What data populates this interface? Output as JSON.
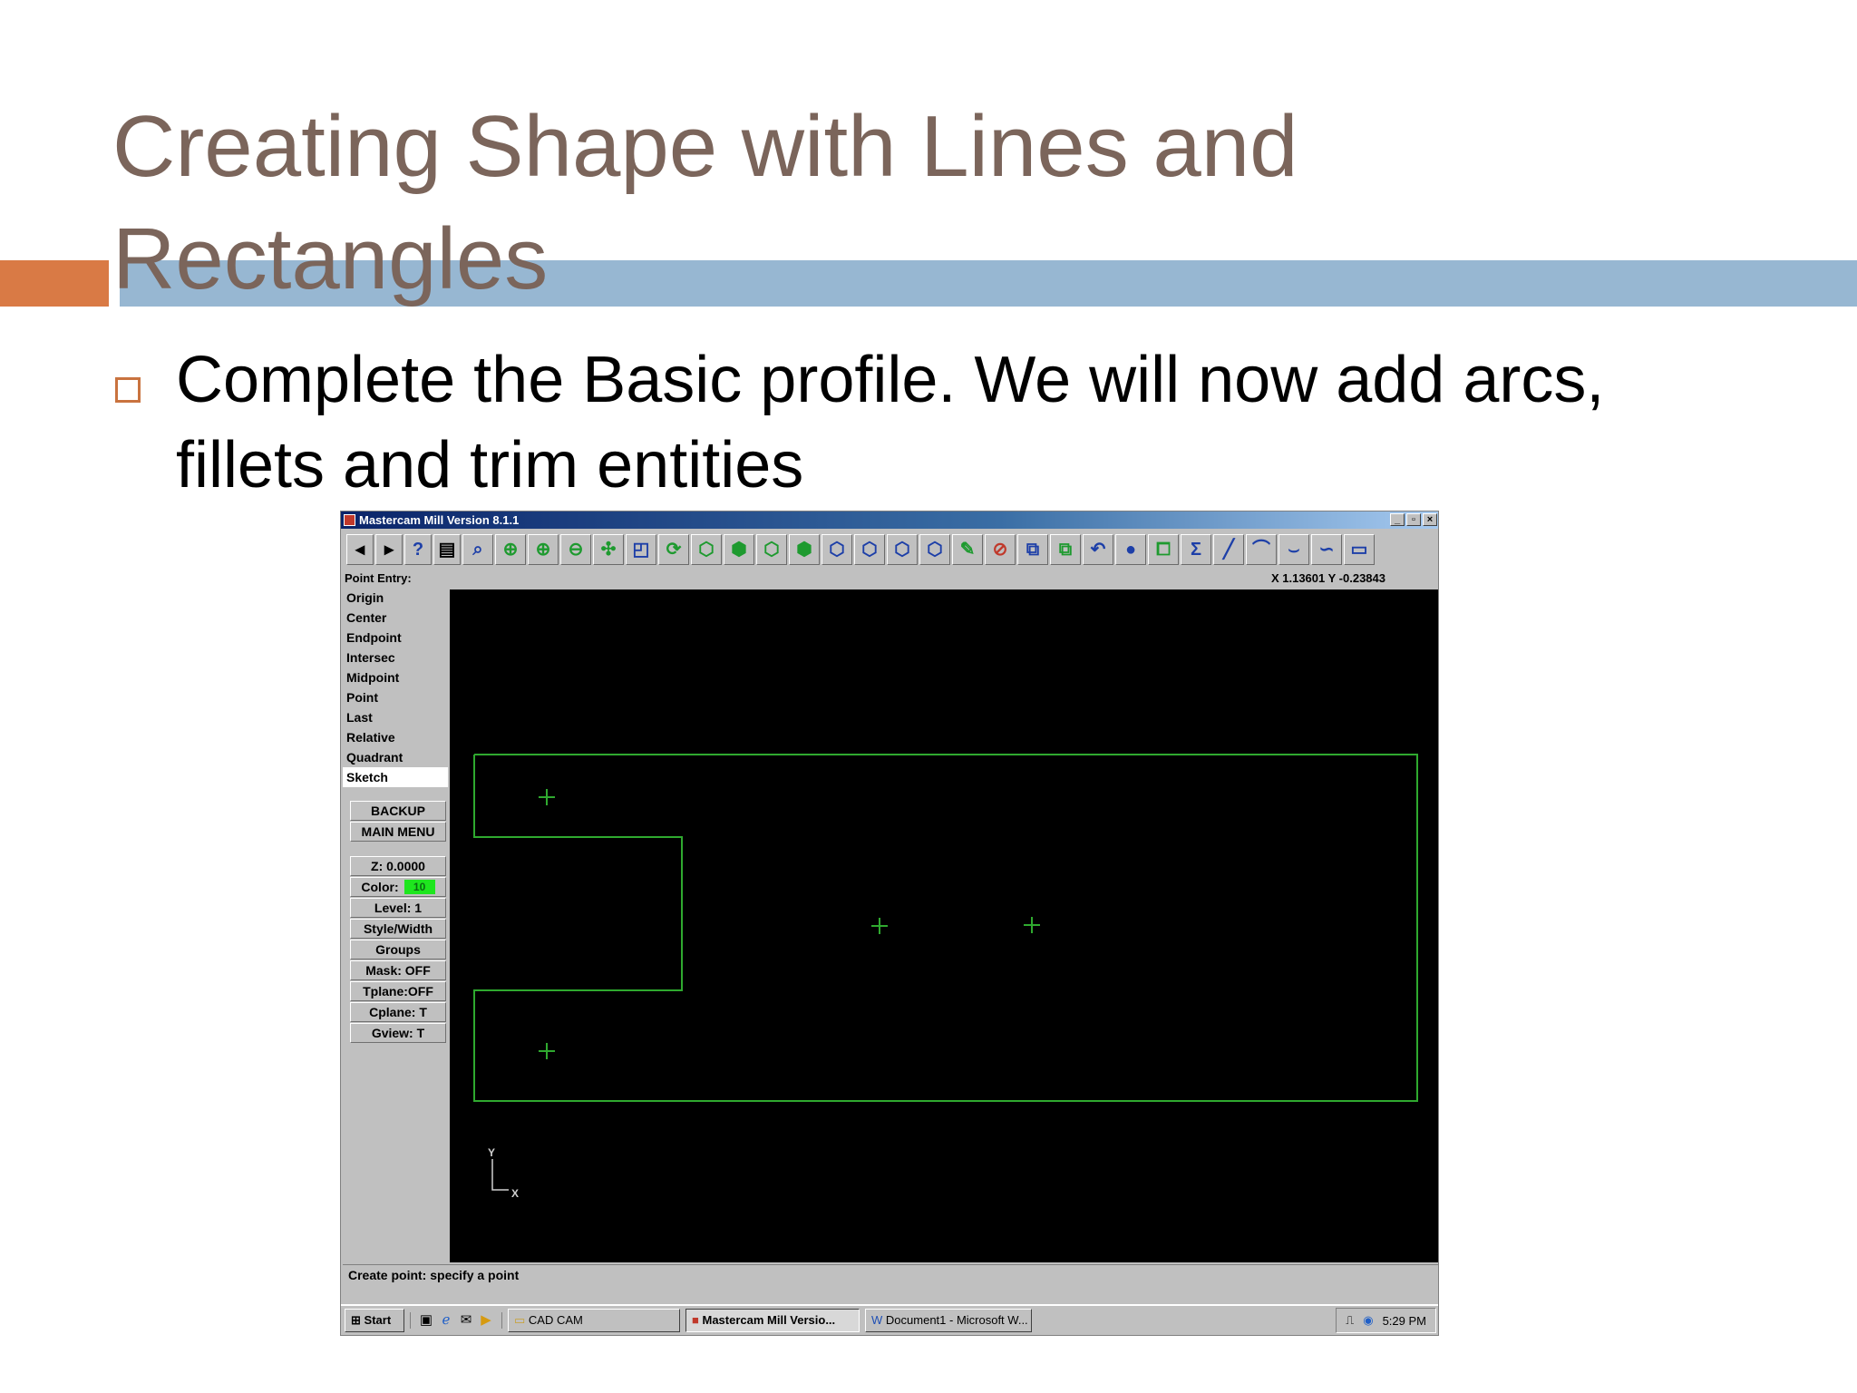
{
  "slide": {
    "title_line1": "Creating Shape with Lines and",
    "title_line2": "Rectangles",
    "bullet": "Complete the Basic profile. We will now add arcs, fillets and trim entities"
  },
  "app": {
    "window_title": "Mastercam Mill Version 8.1.1",
    "win_controls": [
      "_",
      "▫",
      "×"
    ],
    "status_label": "Point Entry:",
    "coords": "X 1.13601  Y -0.23843",
    "point_menu": [
      "Origin",
      "Center",
      "Endpoint",
      "Intersec",
      "Midpoint",
      "Point",
      "Last",
      "Relative",
      "Quadrant",
      "Sketch"
    ],
    "nav_buttons": [
      "BACKUP",
      "MAIN MENU"
    ],
    "z_value": "Z:  0.0000",
    "color_label": "Color:",
    "color_value": "10",
    "settings": [
      "Level:  1",
      "Style/Width",
      "Groups",
      "Mask:  OFF",
      "Tplane:OFF",
      "Cplane:  T",
      "Gview:  T"
    ],
    "axis_y": "Y",
    "axis_x": "X",
    "prompt": "Create point: specify a point",
    "geometry_color": "#2fa92f",
    "canvas_color": "#000000"
  },
  "taskbar": {
    "start": "Start",
    "folder": "CAD CAM",
    "task_active": "Mastercam Mill Versio...",
    "task_doc": "Document1 - Microsoft W...",
    "clock": "5:29 PM"
  }
}
